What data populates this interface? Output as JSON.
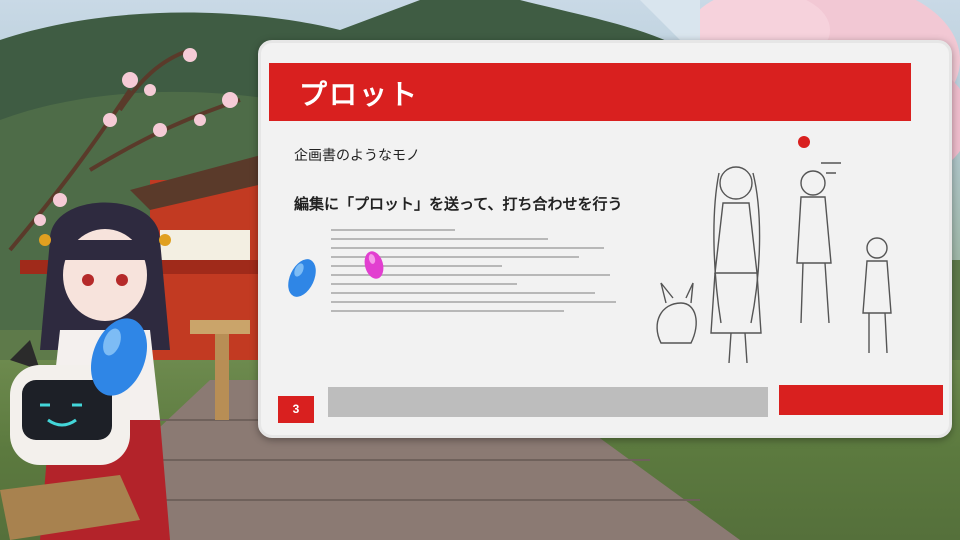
{
  "slide": {
    "title": "プロット",
    "line1": "企画書のようなモノ",
    "line2": "編集に「プロット」を送って、打ち合わせを行う",
    "page_number": "3"
  },
  "colors": {
    "accent_red": "#d9201f",
    "board_bg": "#f2f2f2",
    "progress_gray": "#bdbdbd",
    "pointer_blue": "#2f86e6",
    "pointer_pink": "#e23fd0"
  },
  "icons": [
    "blue-pointer-icon",
    "pink-pointer-icon",
    "robot-face-icon"
  ]
}
